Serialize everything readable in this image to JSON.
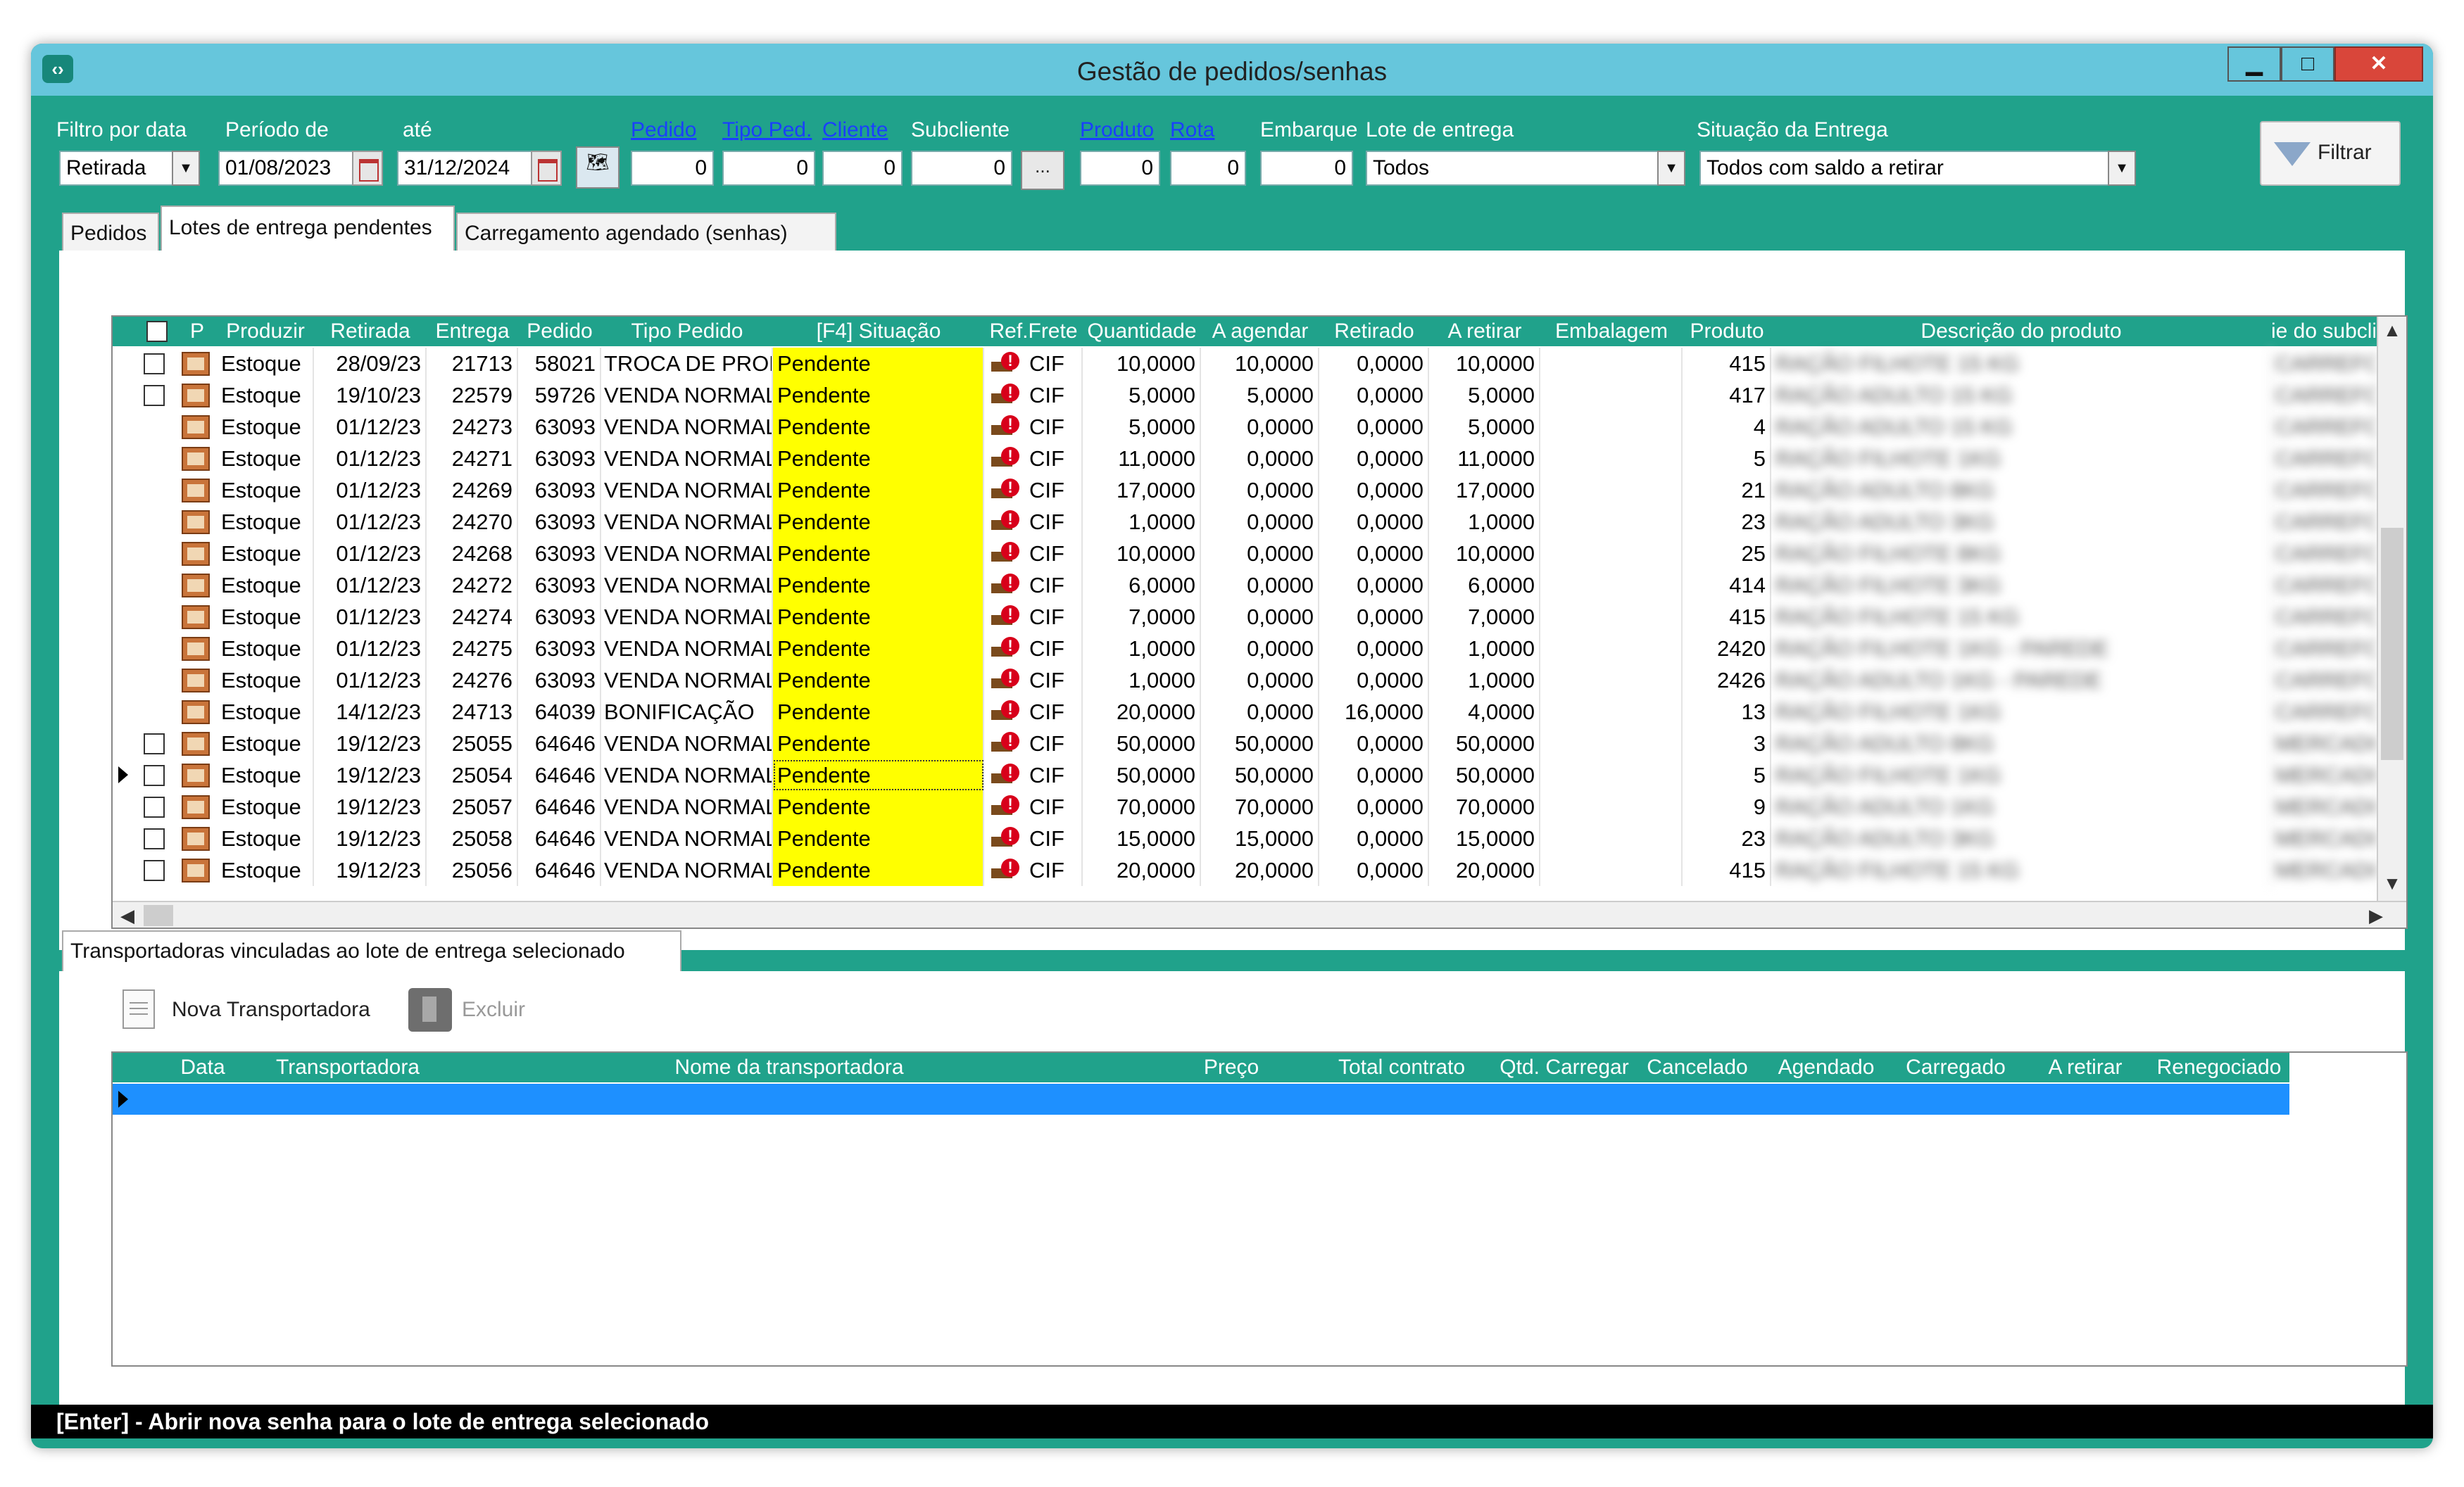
{
  "window": {
    "title": "Gestão de pedidos/senhas",
    "minimize": "▁",
    "maximize": "□",
    "close": "✕",
    "icon": "app-icon"
  },
  "filters": {
    "filtro_por_data": {
      "label": "Filtro por data",
      "value": "Retirada"
    },
    "periodo_de": {
      "label": "Período de",
      "value": "01/08/2023"
    },
    "ate": {
      "label": "até",
      "value": "31/12/2024"
    },
    "pedido": {
      "label": "Pedido",
      "value": "0"
    },
    "tipo_ped": {
      "label": "Tipo Ped.",
      "value": "0"
    },
    "cliente": {
      "label": "Cliente",
      "value": "0"
    },
    "subcliente": {
      "label": "Subcliente",
      "value": "0",
      "button": "..."
    },
    "produto": {
      "label": "Produto",
      "value": "0"
    },
    "rota": {
      "label": "Rota",
      "value": "0"
    },
    "embarque": {
      "label": "Embarque",
      "value": "0"
    },
    "lote_de_entrega": {
      "label": "Lote de entrega",
      "value": "Todos"
    },
    "situacao_entrega": {
      "label": "Situação da Entrega",
      "value": "Todos com saldo a retirar"
    },
    "filtrar_button": "Filtrar"
  },
  "tabs": [
    "Pedidos",
    "Lotes de entrega pendentes",
    "Carregamento agendado (senhas)"
  ],
  "grid": {
    "columns": [
      "P",
      "Produzir",
      "Retirada",
      "Entrega",
      "Pedido",
      "Tipo Pedido",
      "[F4] Situação",
      "Ref.Frete",
      "Quantidade",
      "A agendar",
      "Retirado",
      "A retirar",
      "Embalagem",
      "Produto",
      "Descrição do produto",
      "ie do subcli"
    ],
    "rows": [
      {
        "chk": true,
        "produzir": "Estoque",
        "retirada": "28/09/23",
        "entrega": "21713",
        "pedido": "58021",
        "tipo": "TROCA DE PROD",
        "situacao": "Pendente",
        "frete": "CIF",
        "qtd": "10,0000",
        "agendar": "10,0000",
        "retirado": "0,0000",
        "aretirar": "10,0000",
        "produto": "415",
        "desc": "RAÇÃO FILHOTE 15 KG",
        "sub": "CARREFOUR"
      },
      {
        "chk": true,
        "produzir": "Estoque",
        "retirada": "19/10/23",
        "entrega": "22579",
        "pedido": "59726",
        "tipo": "VENDA NORMAL",
        "situacao": "Pendente",
        "frete": "CIF",
        "qtd": "5,0000",
        "agendar": "5,0000",
        "retirado": "0,0000",
        "aretirar": "5,0000",
        "produto": "417",
        "desc": "RAÇÃO ADULTO 15 KG",
        "sub": "CARREFOUR"
      },
      {
        "chk": false,
        "produzir": "Estoque",
        "retirada": "01/12/23",
        "entrega": "24273",
        "pedido": "63093",
        "tipo": "VENDA NORMAL",
        "situacao": "Pendente",
        "frete": "CIF",
        "qtd": "5,0000",
        "agendar": "0,0000",
        "retirado": "0,0000",
        "aretirar": "5,0000",
        "produto": "4",
        "desc": "RAÇÃO ADULTO 15 KG",
        "sub": "CARREFOUR"
      },
      {
        "chk": false,
        "produzir": "Estoque",
        "retirada": "01/12/23",
        "entrega": "24271",
        "pedido": "63093",
        "tipo": "VENDA NORMAL",
        "situacao": "Pendente",
        "frete": "CIF",
        "qtd": "11,0000",
        "agendar": "0,0000",
        "retirado": "0,0000",
        "aretirar": "11,0000",
        "produto": "5",
        "desc": "RAÇÃO FILHOTE 1KG",
        "sub": "CARREFOUR"
      },
      {
        "chk": false,
        "produzir": "Estoque",
        "retirada": "01/12/23",
        "entrega": "24269",
        "pedido": "63093",
        "tipo": "VENDA NORMAL",
        "situacao": "Pendente",
        "frete": "CIF",
        "qtd": "17,0000",
        "agendar": "0,0000",
        "retirado": "0,0000",
        "aretirar": "17,0000",
        "produto": "21",
        "desc": "RAÇÃO ADULTO 8KG",
        "sub": "CARREFOUR"
      },
      {
        "chk": false,
        "produzir": "Estoque",
        "retirada": "01/12/23",
        "entrega": "24270",
        "pedido": "63093",
        "tipo": "VENDA NORMAL",
        "situacao": "Pendente",
        "frete": "CIF",
        "qtd": "1,0000",
        "agendar": "0,0000",
        "retirado": "0,0000",
        "aretirar": "1,0000",
        "produto": "23",
        "desc": "RAÇÃO ADULTO 3KG",
        "sub": "CARREFOUR"
      },
      {
        "chk": false,
        "produzir": "Estoque",
        "retirada": "01/12/23",
        "entrega": "24268",
        "pedido": "63093",
        "tipo": "VENDA NORMAL",
        "situacao": "Pendente",
        "frete": "CIF",
        "qtd": "10,0000",
        "agendar": "0,0000",
        "retirado": "0,0000",
        "aretirar": "10,0000",
        "produto": "25",
        "desc": "RAÇÃO FILHOTE 8KG",
        "sub": "CARREFOUR"
      },
      {
        "chk": false,
        "produzir": "Estoque",
        "retirada": "01/12/23",
        "entrega": "24272",
        "pedido": "63093",
        "tipo": "VENDA NORMAL",
        "situacao": "Pendente",
        "frete": "CIF",
        "qtd": "6,0000",
        "agendar": "0,0000",
        "retirado": "0,0000",
        "aretirar": "6,0000",
        "produto": "414",
        "desc": "RAÇÃO FILHOTE 3KG",
        "sub": "CARREFOUR"
      },
      {
        "chk": false,
        "produzir": "Estoque",
        "retirada": "01/12/23",
        "entrega": "24274",
        "pedido": "63093",
        "tipo": "VENDA NORMAL",
        "situacao": "Pendente",
        "frete": "CIF",
        "qtd": "7,0000",
        "agendar": "0,0000",
        "retirado": "0,0000",
        "aretirar": "7,0000",
        "produto": "415",
        "desc": "RAÇÃO FILHOTE 15 KG",
        "sub": "CARREFOUR"
      },
      {
        "chk": false,
        "produzir": "Estoque",
        "retirada": "01/12/23",
        "entrega": "24275",
        "pedido": "63093",
        "tipo": "VENDA NORMAL",
        "situacao": "Pendente",
        "frete": "CIF",
        "qtd": "1,0000",
        "agendar": "0,0000",
        "retirado": "0,0000",
        "aretirar": "1,0000",
        "produto": "2420",
        "desc": "RAÇÃO FILHOTE 1KG - PAREDE",
        "sub": "CARREFOUR"
      },
      {
        "chk": false,
        "produzir": "Estoque",
        "retirada": "01/12/23",
        "entrega": "24276",
        "pedido": "63093",
        "tipo": "VENDA NORMAL",
        "situacao": "Pendente",
        "frete": "CIF",
        "qtd": "1,0000",
        "agendar": "0,0000",
        "retirado": "0,0000",
        "aretirar": "1,0000",
        "produto": "2426",
        "desc": "RAÇÃO ADULTO 1KG - PAREDE",
        "sub": "CARREFOUR"
      },
      {
        "chk": false,
        "produzir": "Estoque",
        "retirada": "14/12/23",
        "entrega": "24713",
        "pedido": "64039",
        "tipo": "BONIFICAÇÃO",
        "situacao": "Pendente",
        "frete": "CIF",
        "qtd": "20,0000",
        "agendar": "0,0000",
        "retirado": "16,0000",
        "aretirar": "4,0000",
        "produto": "13",
        "desc": "RAÇÃO FILHOTE 1KG",
        "sub": "CARREFOUR"
      },
      {
        "chk": true,
        "produzir": "Estoque",
        "retirada": "19/12/23",
        "entrega": "25055",
        "pedido": "64646",
        "tipo": "VENDA NORMAL",
        "situacao": "Pendente",
        "frete": "CIF",
        "qtd": "50,0000",
        "agendar": "50,0000",
        "retirado": "0,0000",
        "aretirar": "50,0000",
        "produto": "3",
        "desc": "RAÇÃO ADULTO 8KG",
        "sub": "MERCADO"
      },
      {
        "chk": true,
        "produzir": "Estoque",
        "retirada": "19/12/23",
        "entrega": "25054",
        "pedido": "64646",
        "tipo": "VENDA NORMAL",
        "situacao": "Pendente",
        "frete": "CIF",
        "qtd": "50,0000",
        "agendar": "50,0000",
        "retirado": "0,0000",
        "aretirar": "50,0000",
        "produto": "5",
        "desc": "RAÇÃO FILHOTE 1KG",
        "sub": "MERCADO"
      },
      {
        "chk": true,
        "produzir": "Estoque",
        "retirada": "19/12/23",
        "entrega": "25057",
        "pedido": "64646",
        "tipo": "VENDA NORMAL",
        "situacao": "Pendente",
        "frete": "CIF",
        "qtd": "70,0000",
        "agendar": "70,0000",
        "retirado": "0,0000",
        "aretirar": "70,0000",
        "produto": "9",
        "desc": "RAÇÃO ADULTO 1KG",
        "sub": "MERCADO"
      },
      {
        "chk": true,
        "produzir": "Estoque",
        "retirada": "19/12/23",
        "entrega": "25058",
        "pedido": "64646",
        "tipo": "VENDA NORMAL",
        "situacao": "Pendente",
        "frete": "CIF",
        "qtd": "15,0000",
        "agendar": "15,0000",
        "retirado": "0,0000",
        "aretirar": "15,0000",
        "produto": "23",
        "desc": "RAÇÃO ADULTO 3KG",
        "sub": "MERCADO"
      },
      {
        "chk": true,
        "produzir": "Estoque",
        "retirada": "19/12/23",
        "entrega": "25056",
        "pedido": "64646",
        "tipo": "VENDA NORMAL",
        "situacao": "Pendente",
        "frete": "CIF",
        "qtd": "20,0000",
        "agendar": "20,0000",
        "retirado": "0,0000",
        "aretirar": "20,0000",
        "produto": "415",
        "desc": "RAÇÃO FILHOTE 15 KG",
        "sub": "MERCADO"
      }
    ]
  },
  "bottom": {
    "tab": "Transportadoras vinculadas ao lote de entrega selecionado",
    "nova_transportadora": "Nova Transportadora",
    "excluir": "Excluir",
    "columns": [
      "Data",
      "Transportadora",
      "Nome da transportadora",
      "Preço",
      "Total contrato",
      "Qtd. Carregar",
      "Cancelado",
      "Agendado",
      "Carregado",
      "A retirar",
      "Renegociado"
    ]
  },
  "status_bar": "[Enter] - Abrir nova senha para o lote de entrega selecionado",
  "colors": {
    "window_bg": "#20a28b",
    "titlebar": "#66c6dc",
    "situacao_highlight": "#ffff00",
    "selected_row": "#1e90ff"
  }
}
